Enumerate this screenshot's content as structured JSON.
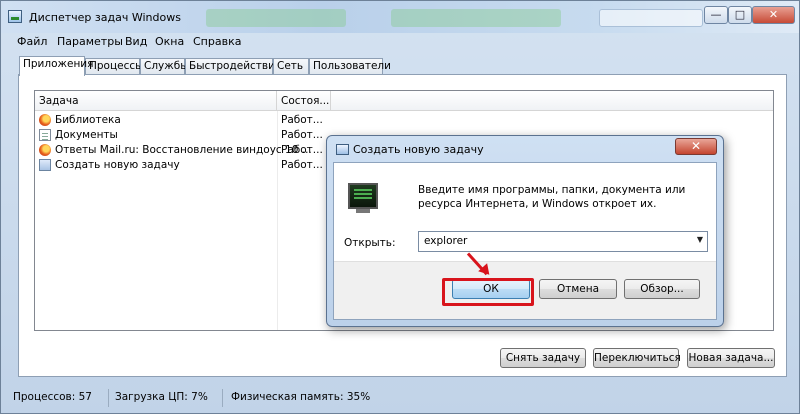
{
  "window": {
    "title": "Диспетчер задач Windows",
    "controls": {
      "minimize": "—",
      "maximize": "□",
      "close": "✕"
    }
  },
  "menu": [
    "Файл",
    "Параметры",
    "Вид",
    "Окна",
    "Справка"
  ],
  "tabs": [
    "Приложения",
    "Процессы",
    "Службы",
    "Быстродействие",
    "Сеть",
    "Пользователи"
  ],
  "list": {
    "columns": {
      "task": "Задача",
      "status": "Состоя..."
    },
    "rows": [
      {
        "name": "Библиотека",
        "status": "Работ...",
        "icon": "firefox-icon"
      },
      {
        "name": "Документы",
        "status": "Работ...",
        "icon": "document-icon"
      },
      {
        "name": "Ответы Mail.ru: Восстановление виндоус 10 ...",
        "status": "Работ...",
        "icon": "firefox-icon"
      },
      {
        "name": "Создать новую задачу",
        "status": "Работ...",
        "icon": "task-window-icon"
      }
    ]
  },
  "buttons": {
    "end_task": "Снять задачу",
    "switch_to": "Переключиться",
    "new_task": "Новая задача..."
  },
  "status_bar": {
    "processes": "Процессов: 57",
    "cpu": "Загрузка ЦП: 7%",
    "memory": "Физическая память: 35%"
  },
  "dialog": {
    "title": "Создать новую задачу",
    "close": "✕",
    "description": "Введите имя программы, папки, документа или ресурса Интернета, и Windows откроет их.",
    "open_label": "Открыть:",
    "open_value": "explorer",
    "ok": "ОК",
    "cancel": "Отмена",
    "browse": "Обзор..."
  },
  "colors": {
    "highlight": "#d8141c",
    "title_gradient": "#c1d3e8"
  }
}
